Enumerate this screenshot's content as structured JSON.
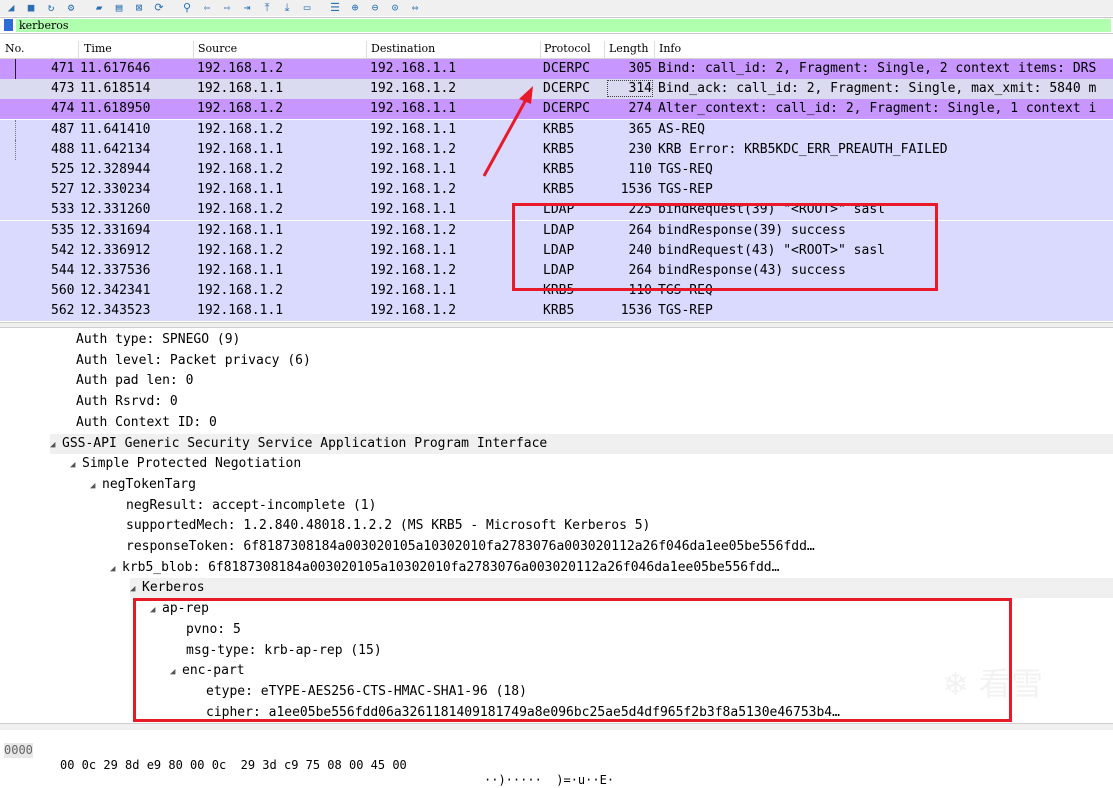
{
  "toolbar": {
    "icons": [
      "shark-fin-icon",
      "stop-icon",
      "restart-icon",
      "options-icon",
      "open-icon",
      "save-icon",
      "close-file-icon",
      "reload-icon",
      "find-icon",
      "back-icon",
      "forward-icon",
      "go-to-icon",
      "first-icon",
      "last-icon",
      "autoscroll-icon",
      "colorize-icon",
      "zoom-in-icon",
      "zoom-out-icon",
      "zoom-reset-icon",
      "resize-columns-icon"
    ]
  },
  "filter": {
    "value": "kerberos"
  },
  "columns": {
    "no": "No.",
    "time": "Time",
    "source": "Source",
    "destination": "Destination",
    "protocol": "Protocol",
    "length": "Length",
    "info": "Info"
  },
  "colors": {
    "dcerpc_bg": "#c797ff",
    "dcerpc_selected_bg": "#dadaf0",
    "krb_bg": "#dadaff",
    "annotation": "#e81a2a",
    "filter_ok": "#afffaf"
  },
  "packets": [
    {
      "no": "471",
      "time": "11.617646",
      "src": "192.168.1.2",
      "dst": "192.168.1.1",
      "proto": "DCERPC",
      "len": "305",
      "info": "Bind: call_id: 2, Fragment: Single, 2 context items: DRS"
    },
    {
      "no": "473",
      "time": "11.618514",
      "src": "192.168.1.1",
      "dst": "192.168.1.2",
      "proto": "DCERPC",
      "len": "314",
      "info": "Bind_ack: call_id: 2, Fragment: Single, max_xmit: 5840 m"
    },
    {
      "no": "474",
      "time": "11.618950",
      "src": "192.168.1.2",
      "dst": "192.168.1.1",
      "proto": "DCERPC",
      "len": "274",
      "info": "Alter_context: call_id: 2, Fragment: Single, 1 context i"
    },
    {
      "no": "487",
      "time": "11.641410",
      "src": "192.168.1.2",
      "dst": "192.168.1.1",
      "proto": "KRB5",
      "len": "365",
      "info": "AS-REQ"
    },
    {
      "no": "488",
      "time": "11.642134",
      "src": "192.168.1.1",
      "dst": "192.168.1.2",
      "proto": "KRB5",
      "len": "230",
      "info": "KRB Error: KRB5KDC_ERR_PREAUTH_FAILED"
    },
    {
      "no": "525",
      "time": "12.328944",
      "src": "192.168.1.2",
      "dst": "192.168.1.1",
      "proto": "KRB5",
      "len": "110",
      "info": "TGS-REQ"
    },
    {
      "no": "527",
      "time": "12.330234",
      "src": "192.168.1.1",
      "dst": "192.168.1.2",
      "proto": "KRB5",
      "len": "1536",
      "info": "TGS-REP"
    },
    {
      "no": "533",
      "time": "12.331260",
      "src": "192.168.1.2",
      "dst": "192.168.1.1",
      "proto": "LDAP",
      "len": "225",
      "info": "bindRequest(39) \"<ROOT>\" sasl"
    },
    {
      "no": "535",
      "time": "12.331694",
      "src": "192.168.1.1",
      "dst": "192.168.1.2",
      "proto": "LDAP",
      "len": "264",
      "info": "bindResponse(39) success"
    },
    {
      "no": "542",
      "time": "12.336912",
      "src": "192.168.1.2",
      "dst": "192.168.1.1",
      "proto": "LDAP",
      "len": "240",
      "info": "bindRequest(43) \"<ROOT>\" sasl"
    },
    {
      "no": "544",
      "time": "12.337536",
      "src": "192.168.1.1",
      "dst": "192.168.1.2",
      "proto": "LDAP",
      "len": "264",
      "info": "bindResponse(43) success"
    },
    {
      "no": "560",
      "time": "12.342341",
      "src": "192.168.1.2",
      "dst": "192.168.1.1",
      "proto": "KRB5",
      "len": "110",
      "info": "TGS-REQ"
    },
    {
      "no": "562",
      "time": "12.343523",
      "src": "192.168.1.1",
      "dst": "192.168.1.2",
      "proto": "KRB5",
      "len": "1536",
      "info": "TGS-REP"
    }
  ],
  "details": [
    {
      "indent": 0,
      "twisty": "",
      "text": "Auth type: SPNEGO (9)"
    },
    {
      "indent": 0,
      "twisty": "",
      "text": "Auth level: Packet privacy (6)"
    },
    {
      "indent": 0,
      "twisty": "",
      "text": "Auth pad len: 0"
    },
    {
      "indent": 0,
      "twisty": "",
      "text": "Auth Rsrvd: 0"
    },
    {
      "indent": 0,
      "twisty": "",
      "text": "Auth Context ID: 0"
    },
    {
      "indent": -1,
      "twisty": "◢",
      "text": "GSS-API Generic Security Service Application Program Interface",
      "hl": true
    },
    {
      "indent": 0,
      "twisty": "◢",
      "text": "Simple Protected Negotiation"
    },
    {
      "indent": 1,
      "twisty": "◢",
      "text": "negTokenTarg"
    },
    {
      "indent": 2.5,
      "twisty": "",
      "text": "negResult: accept-incomplete (1)"
    },
    {
      "indent": 2.5,
      "twisty": "",
      "text": "supportedMech: 1.2.840.48018.1.2.2 (MS KRB5 - Microsoft Kerberos 5)"
    },
    {
      "indent": 2.5,
      "twisty": "",
      "text": "responseToken: 6f8187308184a003020105a10302010fa2783076a003020112a26f046da1ee05be556fdd…"
    },
    {
      "indent": 2,
      "twisty": "◢",
      "text": "krb5_blob: 6f8187308184a003020105a10302010fa2783076a003020112a26f046da1ee05be556fdd…"
    },
    {
      "indent": 3,
      "twisty": "◢",
      "text": "Kerberos",
      "hl": true
    },
    {
      "indent": 4,
      "twisty": "◢",
      "text": "ap-rep"
    },
    {
      "indent": 5.5,
      "twisty": "",
      "text": "pvno: 5"
    },
    {
      "indent": 5.5,
      "twisty": "",
      "text": "msg-type: krb-ap-rep (15)"
    },
    {
      "indent": 5,
      "twisty": "◢",
      "text": "enc-part"
    },
    {
      "indent": 6.5,
      "twisty": "",
      "text": "etype: eTYPE-AES256-CTS-HMAC-SHA1-96 (18)"
    },
    {
      "indent": 6.5,
      "twisty": "",
      "text": "cipher: a1ee05be556fdd06a3261181409181749a8e096bc25ae5d4df965f2b3f8a5130e46753b4…"
    }
  ],
  "bytes": {
    "offset": "0000",
    "hex": "00 0c 29 8d e9 80 00 0c  29 3d c9 75 08 00 45 00",
    "ascii": "··)·····  )=·u··E·"
  },
  "watermark": "看雪"
}
